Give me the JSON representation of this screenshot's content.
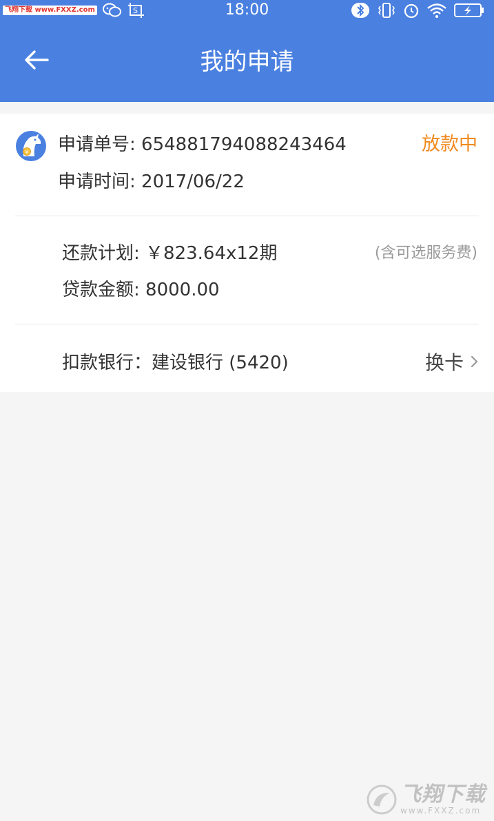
{
  "status_bar": {
    "site_badge": "飞翔下载 www.FXXZ.com",
    "time": "18:00"
  },
  "header": {
    "title": "我的申请"
  },
  "application": {
    "order_label": "申请单号: ",
    "order_number": "654881794088243464",
    "status": "放款中",
    "time_label": "申请时间: ",
    "time_value": "2017/06/22",
    "repayment_label": "还款计划: ",
    "repayment_value": "￥823.64x12期",
    "repayment_note": "(含可选服务费)",
    "loan_label": "贷款金额: ",
    "loan_value": "8000.00",
    "bank_label": "扣款银行：",
    "bank_value": "建设银行 (5420)",
    "change_card_label": "换卡"
  },
  "watermark": {
    "main": "飞翔下载",
    "sub": "www.FXXZ.com"
  },
  "colors": {
    "primary": "#4a80e0",
    "status": "#f08a1e",
    "background": "#f5f5f5"
  }
}
